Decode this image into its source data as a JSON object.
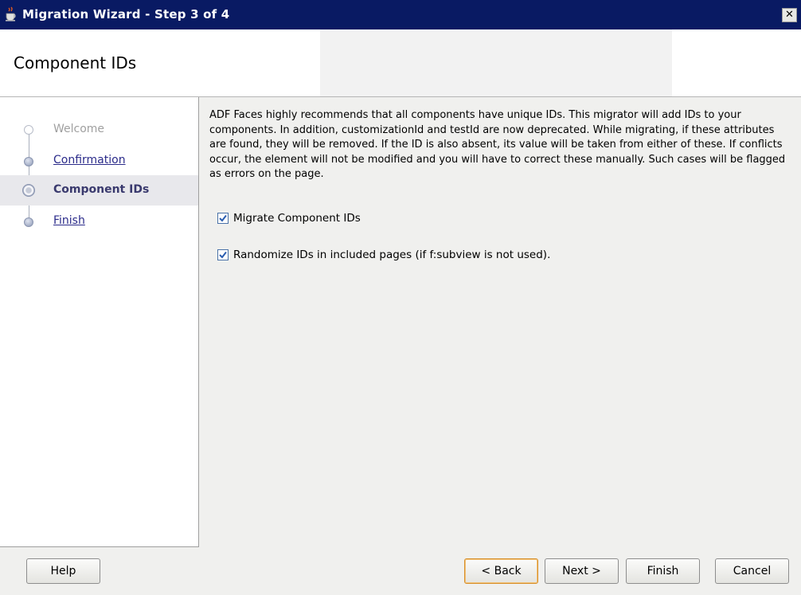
{
  "window": {
    "title": "Migration Wizard - Step 3 of 4",
    "icon": "java-cup-icon",
    "close_symbol": "✕"
  },
  "header": {
    "title": "Component IDs"
  },
  "steps": [
    {
      "label": "Welcome",
      "state": "disabled"
    },
    {
      "label": "Confirmation",
      "state": "link"
    },
    {
      "label": "Component IDs",
      "state": "current"
    },
    {
      "label": "Finish",
      "state": "link"
    }
  ],
  "content": {
    "description": "ADF Faces highly recommends that all components have unique IDs. This migrator will add IDs to your components. In addition, customizationId and testId are now deprecated. While migrating, if these attributes are found, they will be removed. If the ID is also absent, its value will be taken from either of these. If conflicts occur, the element will not be modified and you will have to correct these manually. Such cases will be flagged as errors on the page.",
    "options": [
      {
        "label": "Migrate Component IDs",
        "checked": true
      },
      {
        "label": "Randomize IDs in included pages (if f:subview is not used).",
        "checked": true
      }
    ]
  },
  "buttons": {
    "help": "Help",
    "back": "< Back",
    "next": "Next >",
    "finish": "Finish",
    "cancel": "Cancel"
  },
  "colors": {
    "titlebar": "#091a63",
    "current_step": "#3a3a6e",
    "link": "#2b2b8a",
    "disabled": "#a0a0a0"
  }
}
